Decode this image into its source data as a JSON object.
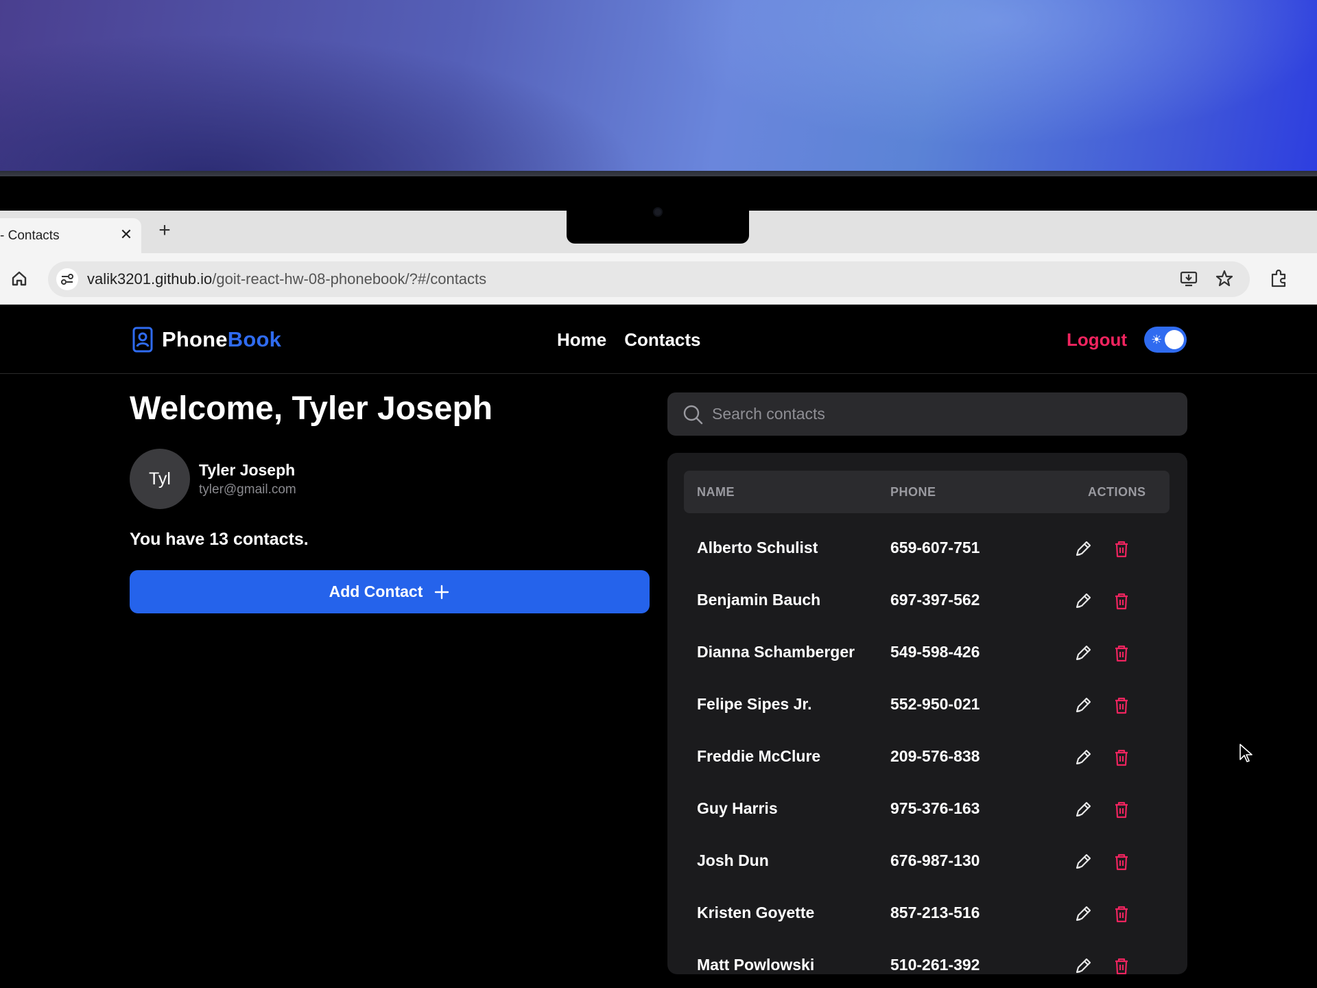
{
  "browser": {
    "tab_title": "- Contacts",
    "url_host": "valik3201.github.io",
    "url_path": "/goit-react-hw-08-phonebook/?#/contacts"
  },
  "header": {
    "logo_part1": "Phone",
    "logo_part2": "Book",
    "nav": [
      "Home",
      "Contacts"
    ],
    "logout_label": "Logout",
    "theme_toggle_on": true
  },
  "user": {
    "welcome": "Welcome, Tyler Joseph",
    "initials": "Tyl",
    "name": "Tyler Joseph",
    "email": "tyler@gmail.com",
    "contacts_count_text": "You have 13 contacts."
  },
  "actions": {
    "add_contact_label": "Add Contact"
  },
  "search": {
    "placeholder": "Search contacts"
  },
  "table": {
    "headers": [
      "NAME",
      "PHONE",
      "ACTIONS"
    ],
    "rows": [
      {
        "name": "Alberto Schulist",
        "phone": "659-607-751"
      },
      {
        "name": "Benjamin Bauch",
        "phone": "697-397-562"
      },
      {
        "name": "Dianna Schamberger",
        "phone": "549-598-426"
      },
      {
        "name": "Felipe Sipes Jr.",
        "phone": "552-950-021"
      },
      {
        "name": "Freddie McClure",
        "phone": "209-576-838"
      },
      {
        "name": "Guy Harris",
        "phone": "975-376-163"
      },
      {
        "name": "Josh Dun",
        "phone": "676-987-130"
      },
      {
        "name": "Kristen Goyette",
        "phone": "857-213-516"
      },
      {
        "name": "Matt Powlowski",
        "phone": "510-261-392"
      }
    ]
  },
  "colors": {
    "accent": "#2563eb",
    "logout": "#f0245f",
    "delete": "#f0245f"
  }
}
